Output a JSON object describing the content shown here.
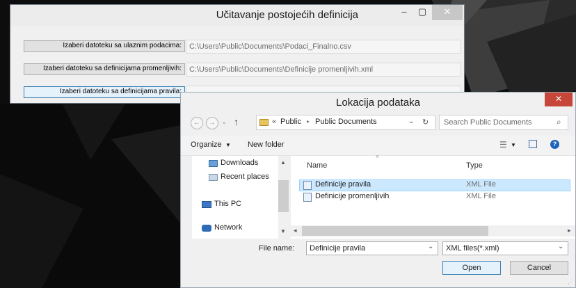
{
  "main_window": {
    "title": "Učitavanje postojećih definicija",
    "minimize_icon": "minimize-icon",
    "maximize_icon": "maximize-icon",
    "close_icon": "close-icon",
    "rows": [
      {
        "button_label": "Izaberi datoteku sa ulaznim podacima:",
        "path": "C:\\Users\\Public\\Documents\\Podaci_Finalno.csv"
      },
      {
        "button_label": "Izaberi datoteku sa definicijama promenljivih:",
        "path": "C:\\Users\\Public\\Documents\\Definicije promenljivih.xml"
      },
      {
        "button_label": "Izaberi datoteku sa definicijama pravila:",
        "path": ""
      }
    ]
  },
  "dialog": {
    "title": "Lokacija podataka",
    "close_glyph": "✕",
    "nav": {
      "back": "←",
      "forward": "→",
      "recent": "⌄",
      "up": "↑"
    },
    "breadcrumb": {
      "prefix": "«",
      "items": [
        "Public",
        "Public Documents"
      ],
      "separator": "▸"
    },
    "refresh": "↻",
    "search_placeholder": "Search Public Documents",
    "toolbar": {
      "organize": "Organize",
      "new_folder": "New folder"
    },
    "nav_pane": [
      {
        "label": "Downloads",
        "icon": "downloads-folder-icon"
      },
      {
        "label": "Recent places",
        "icon": "recent-places-icon"
      },
      {
        "label": "This PC",
        "icon": "this-pc-icon"
      },
      {
        "label": "Network",
        "icon": "network-icon"
      }
    ],
    "columns": {
      "name": "Name",
      "type": "Type"
    },
    "files": [
      {
        "name": "Definicije pravila",
        "type": "XML File",
        "selected": true
      },
      {
        "name": "Definicije promenljivih",
        "type": "XML File",
        "selected": false
      }
    ],
    "file_name_label": "File name:",
    "file_name_value": "Definicije pravila",
    "filter_value": "XML files(*.xml)",
    "open_label": "Open",
    "cancel_label": "Cancel",
    "colors": {
      "selection": "#cce8ff",
      "close_red": "#c7463a",
      "focus_blue": "#3c7fb1"
    }
  }
}
